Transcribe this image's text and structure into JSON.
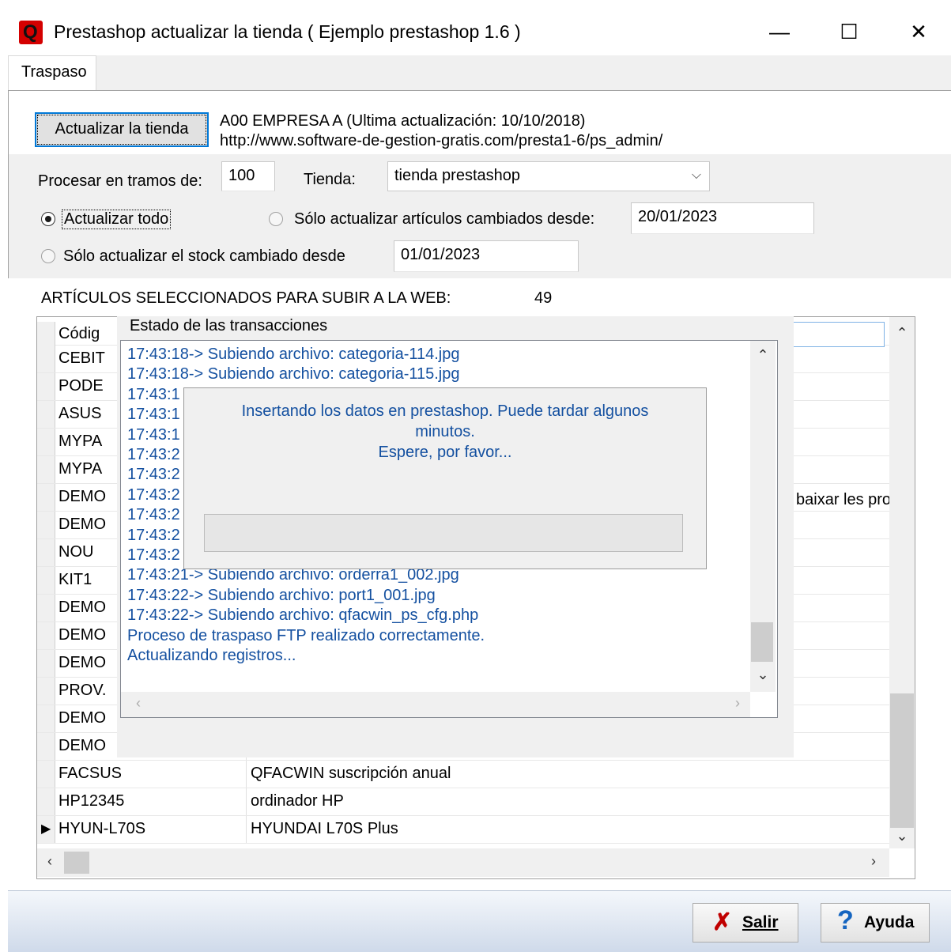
{
  "window": {
    "title": "Prestashop actualizar la tienda ( Ejemplo prestashop 1.6 )",
    "icon_letter": "Q",
    "minimize": "—",
    "maximize": "☐",
    "close": "✕"
  },
  "tabs": [
    {
      "label": "Traspaso",
      "active": true
    }
  ],
  "header": {
    "update_button": "Actualizar la tienda",
    "company_line": "A00 EMPRESA A  (Ultima actualización: 10/10/2018)",
    "url_line": "http://www.software-de-gestion-gratis.com/presta1-6/ps_admin/"
  },
  "options": {
    "tramos_label": "Procesar en tramos de:",
    "tramos_value": "100",
    "tienda_label": "Tienda:",
    "tienda_value": "tienda prestashop",
    "radio_all": "Actualizar todo",
    "radio_changed": "Sólo actualizar artículos cambiados desde:",
    "changed_date": "20/01/2023",
    "radio_stock": "Sólo actualizar el stock cambiado desde",
    "stock_date": "01/01/2023"
  },
  "selected": {
    "label": "ARTÍCULOS SELECCIONADOS PARA SUBIR A LA WEB:",
    "count": "49"
  },
  "grid": {
    "header_code": "Códig",
    "rows": [
      {
        "code": "CEBIT",
        "desc": ""
      },
      {
        "code": "PODE",
        "desc": ""
      },
      {
        "code": "ASUS",
        "desc": ""
      },
      {
        "code": "MYPA",
        "desc": ""
      },
      {
        "code": "MYPA",
        "desc": ""
      },
      {
        "code": "DEMO",
        "desc": ""
      },
      {
        "code": "DEMO",
        "desc": ""
      },
      {
        "code": "NOU",
        "desc": ""
      },
      {
        "code": "KIT1",
        "desc": ""
      },
      {
        "code": "DEMO",
        "desc": ""
      },
      {
        "code": "DEMO",
        "desc": ""
      },
      {
        "code": "DEMO",
        "desc": ""
      },
      {
        "code": "PROV.",
        "desc": ""
      },
      {
        "code": "DEMO",
        "desc": ""
      },
      {
        "code": "DEMO",
        "desc": ""
      },
      {
        "code": "FACSUS",
        "desc": "QFACWIN suscripción anual"
      },
      {
        "code": "HP12345",
        "desc": "ordinador HP"
      },
      {
        "code": "HYUN-L70S",
        "desc": "HYUNDAI L70S Plus"
      }
    ],
    "partial_text": "baixar les pro"
  },
  "transactions": {
    "title": "Estado de las transacciones",
    "lines": [
      "17:43:18-> Subiendo archivo: categoria-114.jpg",
      "17:43:18-> Subiendo archivo: categoria-115.jpg",
      "17:43:1",
      "17:43:1",
      "17:43:1",
      "17:43:2",
      "17:43:2",
      "17:43:2",
      "17:43:2",
      "17:43:2",
      "17:43:2",
      "17:43:21-> Subiendo archivo: orderra1_002.jpg",
      "17:43:22-> Subiendo archivo: port1_001.jpg",
      "17:43:22-> Subiendo archivo: qfacwin_ps_cfg.php",
      "Proceso de traspaso FTP realizado correctamente.",
      "Actualizando registros..."
    ]
  },
  "overlay": {
    "line1": "Insertando los datos en prestashop. Puede tardar algunos",
    "line2": "minutos.",
    "line3": "Espere, por favor..."
  },
  "footer": {
    "exit_label": "Salir",
    "help_label": "Ayuda"
  },
  "colors": {
    "log_text": "#1450a0",
    "exit_icon": "#c00000",
    "help_icon": "#1565c0"
  }
}
